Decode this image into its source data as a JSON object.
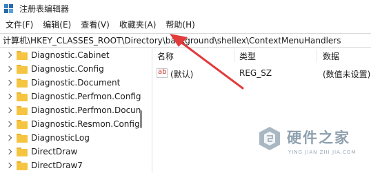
{
  "window": {
    "title": "注册表编辑器"
  },
  "menu": [
    "文件(F)",
    "编辑(E)",
    "查看(V)",
    "收藏夹(A)",
    "帮助(H)"
  ],
  "address": {
    "path": "计算机\\HKEY_CLASSES_ROOT\\Directory\\background\\shellex\\ContextMenuHandlers"
  },
  "tree": {
    "items": [
      "Diagnostic.Cabinet",
      "Diagnostic.Config",
      "Diagnostic.Document",
      "Diagnostic.Perfmon.Config",
      "Diagnostic.Perfmon.Docun",
      "Diagnostic.Resmon.Config",
      "DiagnosticLog",
      "DirectDraw",
      "DirectDraw7"
    ]
  },
  "list": {
    "headers": {
      "name": "名称",
      "type": "类型",
      "data": "数据"
    },
    "rows": [
      {
        "icon": "ab",
        "name": "(默认)",
        "type": "REG_SZ",
        "data": "(数值未设置)"
      }
    ]
  },
  "annotation": {
    "color": "#e23b3b"
  },
  "watermark": {
    "name": "硬件之家",
    "sub": "YING JIAN ZHI JIA.COM"
  }
}
